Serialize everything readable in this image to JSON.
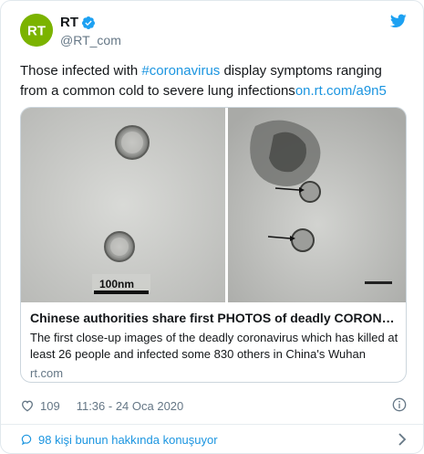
{
  "author": {
    "display_name": "RT",
    "handle": "@RT_com",
    "avatar_text": "RT",
    "avatar_color": "#7bb300",
    "verified": true
  },
  "tweet": {
    "text_before": "Those infected with ",
    "hashtag": "#coronavirus",
    "text_after": " display symptoms ranging from a common cold to severe lung infections",
    "link": "on.rt.com/a9n5"
  },
  "card": {
    "scale_label": "100nm",
    "title": "Chinese authorities share first PHOTOS of deadly CORONAVI...",
    "description": "The first close-up images of the deadly coronavirus which has killed at least 26 people and infected some 830 others in China's Wuhan",
    "domain": "rt.com"
  },
  "meta": {
    "like_count": "109",
    "timestamp": "11:36 - 24 Oca 2020"
  },
  "footer": {
    "conversation_text": "98 kişi bunun hakkında konuşuyor"
  },
  "colors": {
    "link": "#1b95e0",
    "secondary_text": "#657786",
    "border": "#ccd6dd"
  },
  "icons": [
    "verified-badge-icon",
    "twitter-bird-icon",
    "heart-icon",
    "info-icon",
    "comment-bubble-icon",
    "chevron-right-icon"
  ]
}
